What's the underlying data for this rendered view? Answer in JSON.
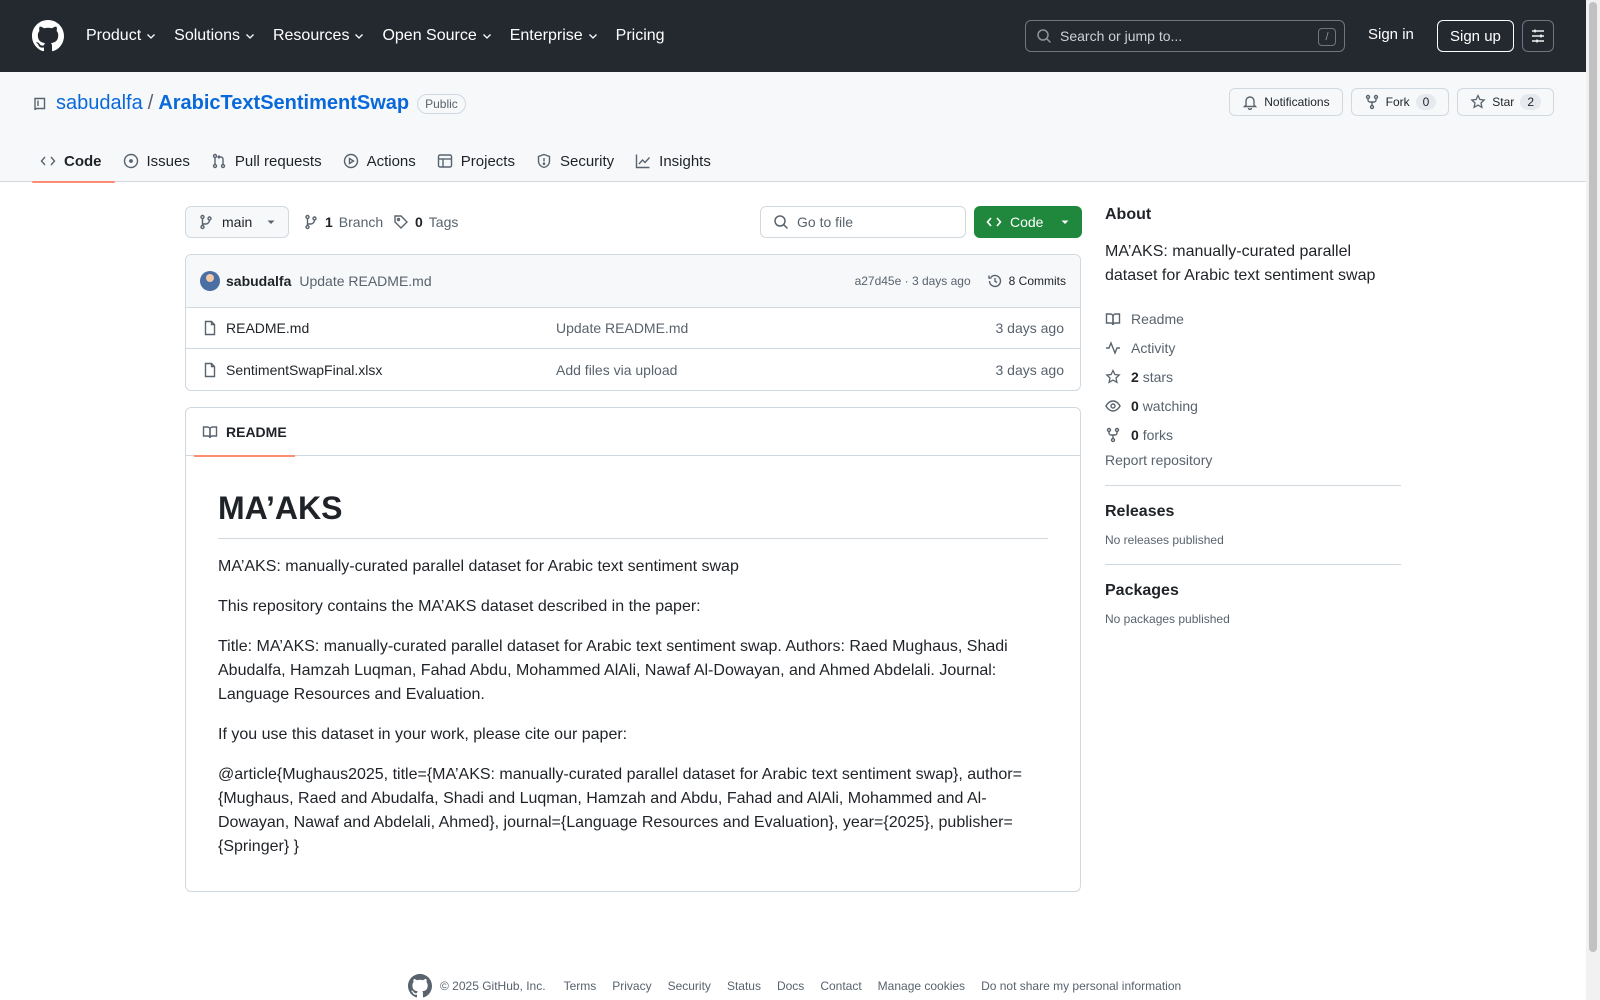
{
  "header": {
    "nav": [
      {
        "label": "Product",
        "dropdown": true
      },
      {
        "label": "Solutions",
        "dropdown": true
      },
      {
        "label": "Resources",
        "dropdown": true
      },
      {
        "label": "Open Source",
        "dropdown": true
      },
      {
        "label": "Enterprise",
        "dropdown": true
      },
      {
        "label": "Pricing",
        "dropdown": false
      }
    ],
    "search_placeholder": "Search or jump to...",
    "search_shortcut": "/",
    "sign_in": "Sign in",
    "sign_up": "Sign up"
  },
  "repo": {
    "owner": "sabudalfa",
    "separator": "/",
    "name": "ArabicTextSentimentSwap",
    "visibility": "Public",
    "notifications_label": "Notifications",
    "fork_label": "Fork",
    "fork_count": "0",
    "star_label": "Star",
    "star_count": "2",
    "tabs": [
      {
        "label": "Code",
        "icon": "code-icon",
        "active": true
      },
      {
        "label": "Issues",
        "icon": "issue-icon",
        "active": false
      },
      {
        "label": "Pull requests",
        "icon": "pull-request-icon",
        "active": false
      },
      {
        "label": "Actions",
        "icon": "play-icon",
        "active": false
      },
      {
        "label": "Projects",
        "icon": "table-icon",
        "active": false
      },
      {
        "label": "Security",
        "icon": "shield-icon",
        "active": false
      },
      {
        "label": "Insights",
        "icon": "graph-icon",
        "active": false
      }
    ]
  },
  "filenav": {
    "branch": "main",
    "branch_count": "1",
    "branch_label": "Branch",
    "tag_count": "0",
    "tag_label": "Tags",
    "goto_placeholder": "Go to file",
    "code_button": "Code"
  },
  "commit": {
    "author": "sabudalfa",
    "message": "Update README.md",
    "hash_time": "a27d45e · 3 days ago",
    "commits_label": "8 Commits"
  },
  "files": [
    {
      "name": "README.md",
      "message": "Update README.md",
      "date": "3 days ago"
    },
    {
      "name": "SentimentSwapFinal.xlsx",
      "message": "Add files via upload",
      "date": "3 days ago"
    }
  ],
  "readme": {
    "tab_label": "README",
    "title": "MA’AKS",
    "paragraphs": [
      "MA’AKS: manually-curated parallel dataset for Arabic text sentiment swap",
      "This repository contains the MA’AKS dataset described in the paper:",
      "Title: MA’AKS: manually-curated parallel dataset for Arabic text sentiment swap. Authors: Raed Mughaus, Shadi Abudalfa, Hamzah Luqman, Fahad Abdu, Mohammed AlAli, Nawaf Al-Dowayan, and Ahmed Abdelali. Journal: Language Resources and Evaluation.",
      "If you use this dataset in your work, please cite our paper:",
      "@article{Mughaus2025, title={MA’AKS: manually-curated parallel dataset for Arabic text sentiment swap}, author={Mughaus, Raed and Abudalfa, Shadi and Luqman, Hamzah and Abdu, Fahad and AlAli, Mohammed and Al-Dowayan, Nawaf and Abdelali, Ahmed}, journal={Language Resources and Evaluation}, year={2025}, publisher={Springer} }"
    ]
  },
  "about": {
    "heading": "About",
    "description": "MA’AKS: manually-curated parallel dataset for Arabic text sentiment swap",
    "readme": "Readme",
    "activity": "Activity",
    "stars_count": "2",
    "stars_label": "stars",
    "watching_count": "0",
    "watching_label": "watching",
    "forks_count": "0",
    "forks_label": "forks",
    "report": "Report repository"
  },
  "releases": {
    "heading": "Releases",
    "empty": "No releases published"
  },
  "packages": {
    "heading": "Packages",
    "empty": "No packages published"
  },
  "footer": {
    "copyright": "© 2025 GitHub, Inc.",
    "links": [
      "Terms",
      "Privacy",
      "Security",
      "Status",
      "Docs",
      "Contact",
      "Manage cookies",
      "Do not share my personal information"
    ]
  }
}
